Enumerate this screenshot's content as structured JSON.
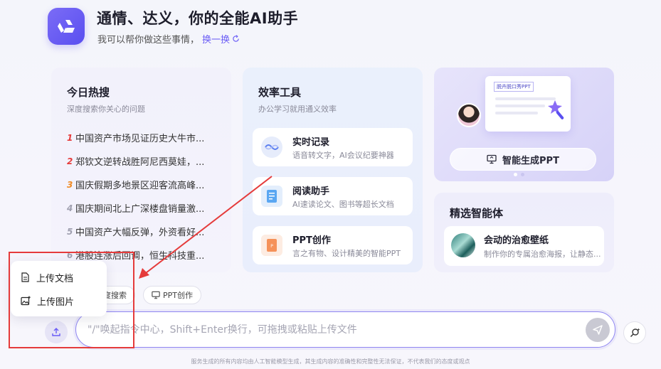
{
  "header": {
    "title": "通情、达义，你的全能AI助手",
    "subtitle": "我可以帮你做这些事情，",
    "refresh_label": "换一换"
  },
  "hot": {
    "title": "今日热搜",
    "subtitle": "深度搜索你关心的问题",
    "items": [
      {
        "rank": "1",
        "text": "中国资产市场见证历史大牛市...",
        "color": "#e53b3b"
      },
      {
        "rank": "2",
        "text": "郑钦文逆转战胜阿尼西莫娃，...",
        "color": "#e53b3b"
      },
      {
        "rank": "3",
        "text": "国庆假期多地景区迎客流高峰...",
        "color": "#f08a24"
      },
      {
        "rank": "4",
        "text": "国庆期间北上广深楼盘销量激...",
        "color": "#a0a0b0"
      },
      {
        "rank": "5",
        "text": "中国资产大幅反弹，外资看好...",
        "color": "#a0a0b0"
      },
      {
        "rank": "6",
        "text": "港股连涨后回调，恒生科技重...",
        "color": "#a0a0b0"
      }
    ]
  },
  "tools": {
    "title": "效率工具",
    "subtitle": "办公学习就用通义效率",
    "items": [
      {
        "name": "实时记录",
        "desc": "语音转文字，AI会议纪要神器"
      },
      {
        "name": "阅读助手",
        "desc": "AI速读论文、图书等超长文档"
      },
      {
        "name": "PPT创作",
        "desc": "言之有物、设计精美的智能PPT"
      }
    ]
  },
  "ppt_banner": {
    "board_label": "脱卉脱口秀PPT",
    "button_label": "智能生成PPT"
  },
  "agents": {
    "title": "精选智能体",
    "items": [
      {
        "name": "会动的治愈壁纸",
        "desc": "制作你的专属治愈海报，让静态..."
      }
    ]
  },
  "chips": {
    "search_label": "度搜索",
    "ppt_label": "PPT创作"
  },
  "upload_menu": {
    "doc_label": "上传文档",
    "image_label": "上传图片"
  },
  "input": {
    "placeholder": "\"/\"唤起指令中心，Shift+Enter换行，可拖拽或粘贴上传文件"
  },
  "footer": {
    "text": "服务生成的所有内容均由人工智能模型生成，其生成内容的准确性和完整性无法保证，不代表我们的态度或观点"
  },
  "colors": {
    "accent": "#6a5cf6",
    "annotation": "#e53b3b"
  }
}
